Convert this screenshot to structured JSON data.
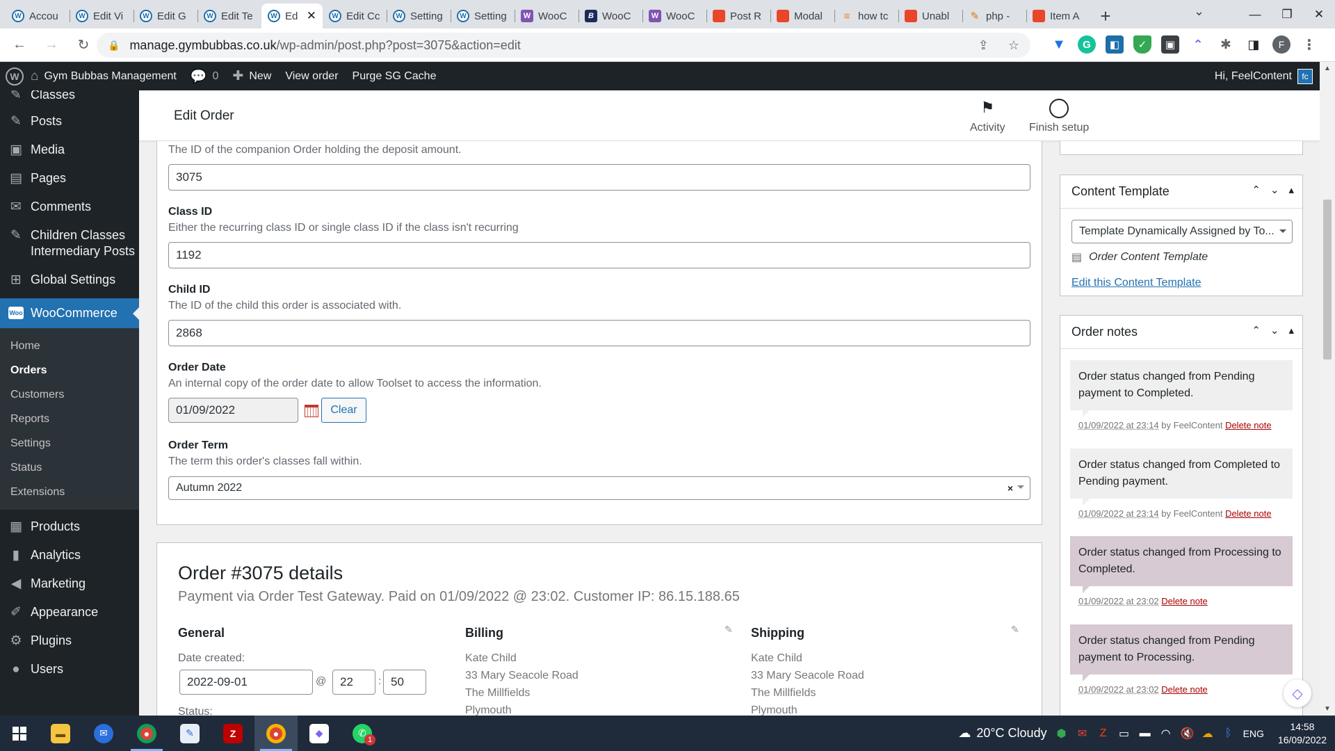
{
  "browser": {
    "tabs": [
      {
        "label": "Accou",
        "icon": "wordpress-icon"
      },
      {
        "label": "Edit Vi",
        "icon": "wordpress-icon"
      },
      {
        "label": "Edit G",
        "icon": "wordpress-icon"
      },
      {
        "label": "Edit Te",
        "icon": "wordpress-icon"
      },
      {
        "label": "Ed",
        "icon": "wordpress-icon",
        "active": true
      },
      {
        "label": "Edit Cc",
        "icon": "wordpress-icon"
      },
      {
        "label": "Setting",
        "icon": "wordpress-icon"
      },
      {
        "label": "Setting",
        "icon": "wordpress-icon"
      },
      {
        "label": "WooC",
        "icon": "woocommerce-icon"
      },
      {
        "label": "WooC",
        "icon": "bootstrap-icon"
      },
      {
        "label": "WooC",
        "icon": "woocommerce-icon"
      },
      {
        "label": "Post R",
        "icon": "red-bag-icon"
      },
      {
        "label": "Modal",
        "icon": "red-bag-icon"
      },
      {
        "label": "how tc",
        "icon": "stackoverflow-icon"
      },
      {
        "label": "Unabl",
        "icon": "red-bag-icon"
      },
      {
        "label": "php -",
        "icon": "pen-icon"
      },
      {
        "label": "Item A",
        "icon": "red-bag-icon"
      }
    ],
    "url_domain": "manage.gymbubbas.co.uk",
    "url_path": "/wp-admin/post.php?post=3075&action=edit",
    "profile_initial": "F"
  },
  "adminbar": {
    "site_name": "Gym Bubbas Management",
    "comments_count": "0",
    "new_label": "New",
    "view_order": "View order",
    "purge_cache": "Purge SG Cache",
    "greeting": "Hi, FeelContent",
    "avatar_text": "fc"
  },
  "sidebar": {
    "clipped_item": "Classes",
    "items_top": [
      {
        "label": "Posts",
        "icon": "pushpin-icon"
      },
      {
        "label": "Media",
        "icon": "media-icon"
      },
      {
        "label": "Pages",
        "icon": "pages-icon"
      },
      {
        "label": "Comments",
        "icon": "comment-icon"
      },
      {
        "label": "Children Classes Intermediary Posts",
        "icon": "pushpin-icon"
      },
      {
        "label": "Global Settings",
        "icon": "settings-icon"
      }
    ],
    "woocommerce": "WooCommerce",
    "woo_icon_text": "Woo",
    "woo_sub": [
      "Home",
      "Orders",
      "Customers",
      "Reports",
      "Settings",
      "Status",
      "Extensions"
    ],
    "woo_current": "Orders",
    "items_bottom": [
      {
        "label": "Products",
        "icon": "products-icon"
      },
      {
        "label": "Analytics",
        "icon": "analytics-icon"
      },
      {
        "label": "Marketing",
        "icon": "megaphone-icon"
      },
      {
        "label": "Appearance",
        "icon": "brush-icon"
      },
      {
        "label": "Plugins",
        "icon": "plugin-icon"
      },
      {
        "label": "Users",
        "icon": "users-icon"
      }
    ]
  },
  "header": {
    "title": "Edit Order",
    "activity": "Activity",
    "finish_setup": "Finish setup"
  },
  "fields": {
    "deposit_desc": "The ID of the companion Order holding the deposit amount.",
    "deposit_value": "3075",
    "class_label": "Class ID",
    "class_desc": "Either the recurring class ID or single class ID if the class isn't recurring",
    "class_value": "1192",
    "child_label": "Child ID",
    "child_desc": "The ID of the child this order is associated with.",
    "child_value": "2868",
    "date_label": "Order Date",
    "date_desc": "An internal copy of the order date to allow Toolset to access the information.",
    "date_value": "01/09/2022",
    "clear_label": "Clear",
    "term_label": "Order Term",
    "term_desc": "The term this order's classes fall within.",
    "term_value": "Autumn 2022",
    "term_clear": "×"
  },
  "order": {
    "title": "Order #3075 details",
    "subtitle": "Payment via Order Test Gateway. Paid on 01/09/2022 @ 23:02. Customer IP: 86.15.188.65",
    "general_label": "General",
    "date_created_label": "Date created:",
    "date_created": "2022-09-01",
    "at": "@",
    "hour": "22",
    "colon": ":",
    "minute": "50",
    "status_label": "Status:",
    "billing_label": "Billing",
    "billing_lines": [
      "Kate Child",
      "33 Mary Seacole Road",
      "The Millfields",
      "Plymouth"
    ],
    "shipping_label": "Shipping",
    "shipping_lines": [
      "Kate Child",
      "33 Mary Seacole Road",
      "The Millfields",
      "Plymouth"
    ]
  },
  "content_template": {
    "title": "Content Template",
    "select_value": "Template Dynamically Assigned by To...",
    "template_name": "Order Content Template",
    "edit_link": "Edit this Content Template"
  },
  "order_notes": {
    "title": "Order notes",
    "notes": [
      {
        "text": "Order status changed from Pending payment to Completed.",
        "date": "01/09/2022 at 23:14",
        "by": " by FeelContent ",
        "delete": "Delete note",
        "system": false
      },
      {
        "text": "Order status changed from Completed to Pending payment.",
        "date": "01/09/2022 at 23:14",
        "by": " by FeelContent ",
        "delete": "Delete note",
        "system": false
      },
      {
        "text": "Order status changed from Processing to Completed.",
        "date": "01/09/2022 at 23:02",
        "by": " ",
        "delete": "Delete note",
        "system": true
      },
      {
        "text": "Order status changed from Pending payment to Processing.",
        "date": "01/09/2022 at 23:02",
        "by": " ",
        "delete": "Delete note",
        "system": true
      }
    ]
  },
  "taskbar": {
    "weather": "20°C  Cloudy",
    "language": "ENG",
    "time": "14:58",
    "date": "16/09/2022",
    "whatsapp_badge": "1"
  }
}
